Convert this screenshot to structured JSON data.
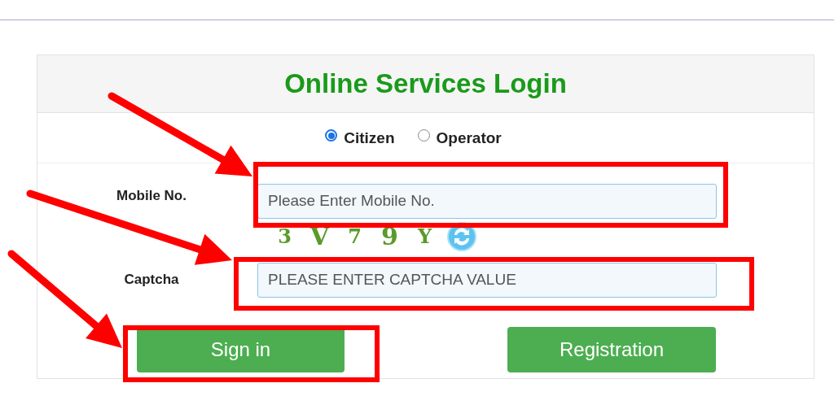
{
  "title": "Online Services Login",
  "user_types": [
    {
      "label": "Citizen",
      "selected": true
    },
    {
      "label": "Operator",
      "selected": false
    }
  ],
  "fields": [
    {
      "label": "Mobile No.",
      "placeholder": "Please Enter Mobile No.",
      "kind": "text"
    },
    {
      "label": "Captcha",
      "placeholder": "PLEASE ENTER CAPTCHA VALUE",
      "kind": "captcha",
      "captcha_chars": [
        "3",
        "V",
        "7",
        "9",
        "Y"
      ]
    }
  ],
  "buttons": [
    "Sign in",
    "Registration"
  ]
}
